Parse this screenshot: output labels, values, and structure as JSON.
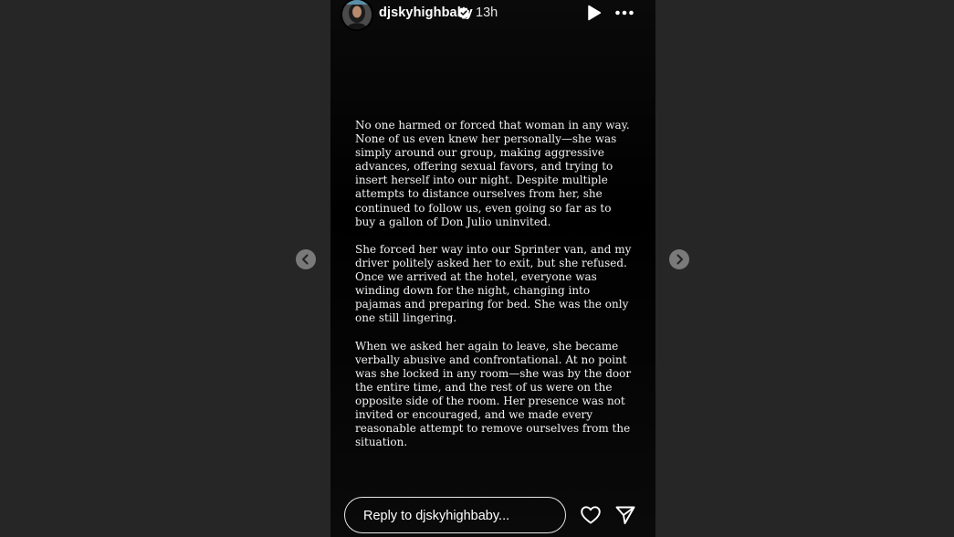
{
  "header": {
    "username": "djskyhighbaby",
    "time": "13h",
    "avatar_icon": "profile-photo",
    "verified_icon": "verified-badge-icon",
    "play_icon": "play-icon",
    "more_icon": "more-horizontal-icon"
  },
  "statement": {
    "paragraphs": [
      "No one harmed or forced that woman in any way. None of us even knew her personally—she was simply around our group, making aggressive advances, offering sexual favors, and trying to insert herself into our night. Despite multiple attempts to distance ourselves from her, she continued to follow us, even going so far as to buy a gallon of Don Julio uninvited.",
      "She forced her way into our Sprinter van, and my driver politely asked her to exit, but she refused. Once we arrived at the hotel, everyone was winding down for the night, changing into pajamas and preparing for bed. She was the only one still lingering.",
      "When we asked her again to leave, she became verbally abusive and confrontational. At no point was she locked in any room—she was by the door the entire time, and the rest of us were on the opposite side of the room. Her presence was not invited or encouraged, and we made every reasonable attempt to remove ourselves from the situation."
    ]
  },
  "footer": {
    "reply_placeholder": "Reply to djskyhighbaby...",
    "like_icon": "heart-icon",
    "share_icon": "send-icon"
  },
  "nav": {
    "prev_icon": "chevron-left-icon",
    "next_icon": "chevron-right-icon"
  },
  "colors": {
    "page_background": "#262626",
    "story_background": "#000000",
    "text": "#ffffff",
    "verified_blue": "#ffffff"
  }
}
